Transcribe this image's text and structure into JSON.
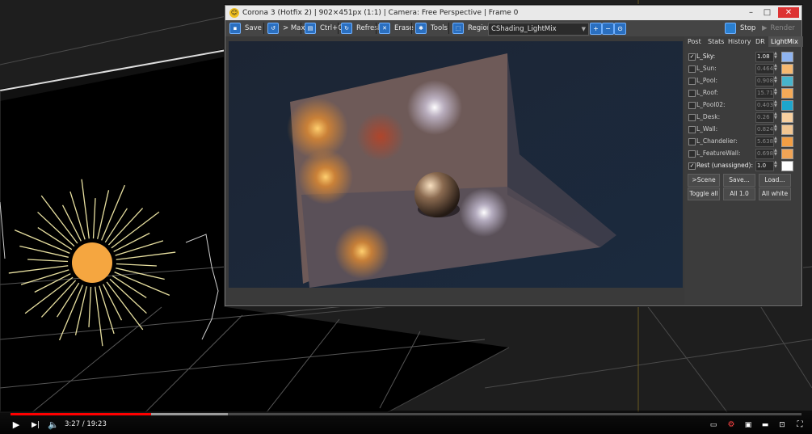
{
  "vfb": {
    "title": "Corona 3 (Hotfix 2) | 902×451px (1:1) | Camera: Free Perspective | Frame 0",
    "toolbar": {
      "save": "Save",
      "max": "> Max",
      "copy": "Ctrl+C",
      "refresh": "Refresh",
      "erase": "Erase",
      "tools": "Tools",
      "region": "Region",
      "channel": "CShading_LightMix",
      "stop": "Stop",
      "render": "Render"
    },
    "tabs": [
      "Post",
      "Stats",
      "History",
      "DR",
      "LightMix"
    ],
    "active_tab": "LightMix",
    "lightmix": [
      {
        "name": "L_Sky:",
        "value": "1.08",
        "enabled": true,
        "color": "#8fb4f0"
      },
      {
        "name": "L_Sun:",
        "value": "0.464",
        "enabled": false,
        "color": "#f6b870"
      },
      {
        "name": "L_Pool:",
        "value": "0.908",
        "enabled": false,
        "color": "#47b4cc"
      },
      {
        "name": "L_Roof:",
        "value": "15.71",
        "enabled": false,
        "color": "#f4aa58"
      },
      {
        "name": "L_Pool02:",
        "value": "0.403",
        "enabled": false,
        "color": "#1ea6cc"
      },
      {
        "name": "L_Desk:",
        "value": "0.26",
        "enabled": false,
        "color": "#f8d0a0"
      },
      {
        "name": "L_Wall:",
        "value": "0.824",
        "enabled": false,
        "color": "#f2c692"
      },
      {
        "name": "L_Chandelier:",
        "value": "5.638",
        "enabled": false,
        "color": "#f29e44"
      },
      {
        "name": "L_FeatureWall:",
        "value": "0.698",
        "enabled": false,
        "color": "#f0a456"
      },
      {
        "name": "Rest (unassigned):",
        "value": "1.0",
        "enabled": true,
        "color": "#ffffff"
      }
    ],
    "buttons": {
      "to_scene": ">Scene",
      "save": "Save...",
      "load": "Load...",
      "toggle_all": "Toggle all",
      "all_one": "All 1.0",
      "all_white": "All white"
    }
  },
  "player": {
    "time": "3:27 / 19:23",
    "progress": 0.178,
    "buffered": 0.275
  }
}
